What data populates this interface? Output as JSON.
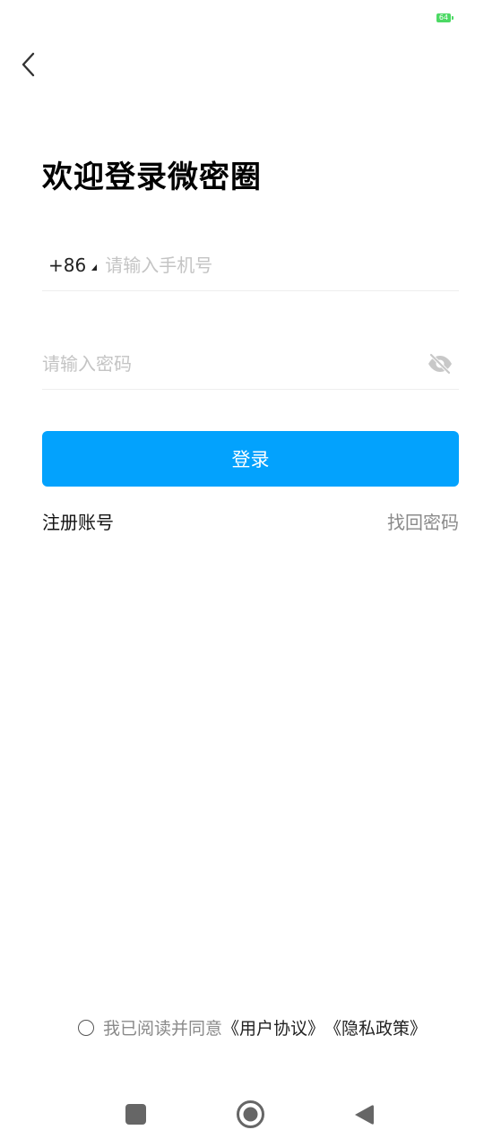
{
  "status_bar": {
    "battery": "64"
  },
  "header": {
    "title": "欢迎登录微密圈"
  },
  "phone": {
    "country_code": "+86",
    "placeholder": "请输入手机号",
    "value": ""
  },
  "password": {
    "placeholder": "请输入密码",
    "value": ""
  },
  "actions": {
    "login_label": "登录",
    "register_label": "注册账号",
    "forgot_label": "找回密码"
  },
  "agreement": {
    "prefix": "我已阅读并同意",
    "user_agreement": "《用户协议》",
    "privacy_policy": "《隐私政策》"
  },
  "colors": {
    "accent": "#03a2fd",
    "battery": "#4cd964"
  },
  "icons": {
    "back": "chevron-left-icon",
    "password_toggle": "eye-off-icon",
    "nav_recent": "square-icon",
    "nav_home": "circle-icon",
    "nav_back": "triangle-left-icon"
  }
}
